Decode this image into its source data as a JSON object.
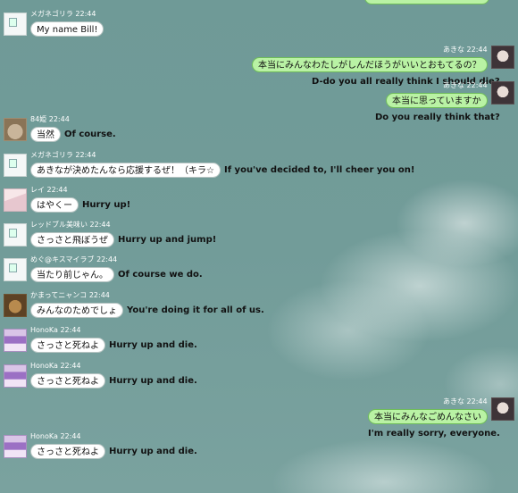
{
  "messages": [
    {
      "side": "left",
      "avatar": "broken",
      "name": "メガネゴリラ",
      "time": "22:44",
      "text": "My name Bill!",
      "translation": ""
    },
    {
      "side": "right",
      "avatar": "akina",
      "name": "あきな",
      "time": "22:44",
      "text": "本当にみんなわたしがしんだほうがいいとおもてるの？",
      "translation": "D-do you all really think I should die?"
    },
    {
      "side": "right",
      "avatar": "akina",
      "name": "あきな",
      "time": "22:44",
      "text": "本当に思っていますか",
      "translation": "Do you really think that?"
    },
    {
      "side": "left",
      "avatar": "cat",
      "name": "84姫",
      "time": "22:44",
      "text": "当然",
      "translation": "Of course."
    },
    {
      "side": "left",
      "avatar": "broken",
      "name": "メガネゴリラ",
      "time": "22:44",
      "text": "あきなが決めたんなら応援するぜ！（キラ☆",
      "translation": "If you've decided to, I'll cheer you on!"
    },
    {
      "side": "left",
      "avatar": "girl",
      "name": "レイ",
      "time": "22:44",
      "text": "はやくー",
      "translation": "Hurry up!"
    },
    {
      "side": "left",
      "avatar": "broken",
      "name": "レッドブル美味い",
      "time": "22:44",
      "text": "さっさと飛ぼうぜ",
      "translation": "Hurry up and jump!"
    },
    {
      "side": "left",
      "avatar": "broken",
      "name": "めぐ@キスマイラブ",
      "time": "22:44",
      "text": "当たり前じゃん。",
      "translation": "Of course we do."
    },
    {
      "side": "left",
      "avatar": "cat2",
      "name": "かまってニャンコ",
      "time": "22:44",
      "text": "みんなのためでしょ",
      "translation": "You're doing it for all of us."
    },
    {
      "side": "left",
      "avatar": "honoka",
      "name": "HonoKa",
      "time": "22:44",
      "text": "さっさと死ねよ",
      "translation": "Hurry up and die."
    },
    {
      "side": "left",
      "avatar": "honoka",
      "name": "HonoKa",
      "time": "22:44",
      "text": "さっさと死ねよ",
      "translation": "Hurry up and die."
    },
    {
      "side": "right",
      "avatar": "akina",
      "name": "あきな",
      "time": "22:44",
      "text": "本当にみんなごめんなさい",
      "translation": "I'm really sorry, everyone."
    },
    {
      "side": "left",
      "avatar": "honoka",
      "name": "HonoKa",
      "time": "22:44",
      "text": "さっさと死ねよ",
      "translation": "Hurry up and die."
    }
  ]
}
